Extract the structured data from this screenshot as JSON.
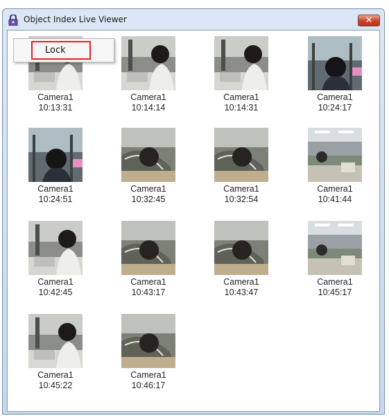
{
  "window": {
    "title": "Object Index Live Viewer",
    "close_label": "✕"
  },
  "context_menu": {
    "items": [
      {
        "label": "Lock"
      }
    ]
  },
  "thumbnails": [
    {
      "camera": "Camera1",
      "time": "10:13:31",
      "scene": "a"
    },
    {
      "camera": "Camera1",
      "time": "10:14:14",
      "scene": "a"
    },
    {
      "camera": "Camera1",
      "time": "10:14:31",
      "scene": "a"
    },
    {
      "camera": "Camera1",
      "time": "10:24:17",
      "scene": "b"
    },
    {
      "camera": "Camera1",
      "time": "10:24:51",
      "scene": "b"
    },
    {
      "camera": "Camera1",
      "time": "10:32:45",
      "scene": "c"
    },
    {
      "camera": "Camera1",
      "time": "10:32:54",
      "scene": "c"
    },
    {
      "camera": "Camera1",
      "time": "10:41:44",
      "scene": "d"
    },
    {
      "camera": "Camera1",
      "time": "10:42:45",
      "scene": "a"
    },
    {
      "camera": "Camera1",
      "time": "10:43:17",
      "scene": "c"
    },
    {
      "camera": "Camera1",
      "time": "10:43:47",
      "scene": "c"
    },
    {
      "camera": "Camera1",
      "time": "10:45:17",
      "scene": "d"
    },
    {
      "camera": "Camera1",
      "time": "10:45:22",
      "scene": "a"
    },
    {
      "camera": "Camera1",
      "time": "10:46:17",
      "scene": "c"
    }
  ],
  "colors": {
    "titlebar": "#c6d8ee",
    "close": "#c7442a",
    "menu_highlight": "#e02424"
  }
}
